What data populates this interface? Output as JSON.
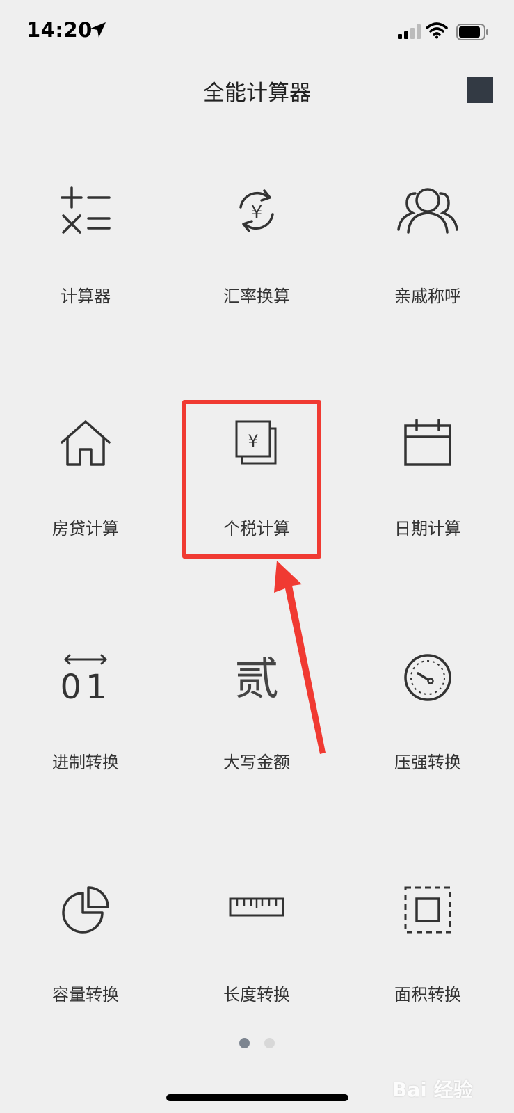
{
  "status": {
    "time": "14:20"
  },
  "header": {
    "title": "全能计算器"
  },
  "grid": {
    "items": [
      {
        "label": "计算器"
      },
      {
        "label": "汇率换算"
      },
      {
        "label": "亲戚称呼"
      },
      {
        "label": "房贷计算"
      },
      {
        "label": "个税计算"
      },
      {
        "label": "日期计算"
      },
      {
        "label": "进制转换"
      },
      {
        "label": "大写金额"
      },
      {
        "label": "压强转换"
      },
      {
        "label": "容量转换"
      },
      {
        "label": "长度转换"
      },
      {
        "label": "面积转换"
      }
    ]
  },
  "icons": {
    "calculator": "plus-minus-times-equals-icon",
    "exchange": "yen-refresh-icon",
    "relatives": "people-icon",
    "mortgage": "house-icon",
    "tax": "yen-document-icon",
    "date": "calendar-icon",
    "base": "binary-icon",
    "capital": "chinese-two-icon",
    "pressure": "gauge-icon",
    "volume": "pie-icon",
    "length": "ruler-icon",
    "area": "area-square-icon"
  },
  "icon_glyphs": {
    "capital": "贰",
    "base": "01",
    "yen": "¥"
  },
  "pagination": {
    "current": 1,
    "total": 2
  },
  "annotation": {
    "highlight_color": "#f03a32"
  },
  "watermark": {
    "text": "Bai 经验"
  }
}
